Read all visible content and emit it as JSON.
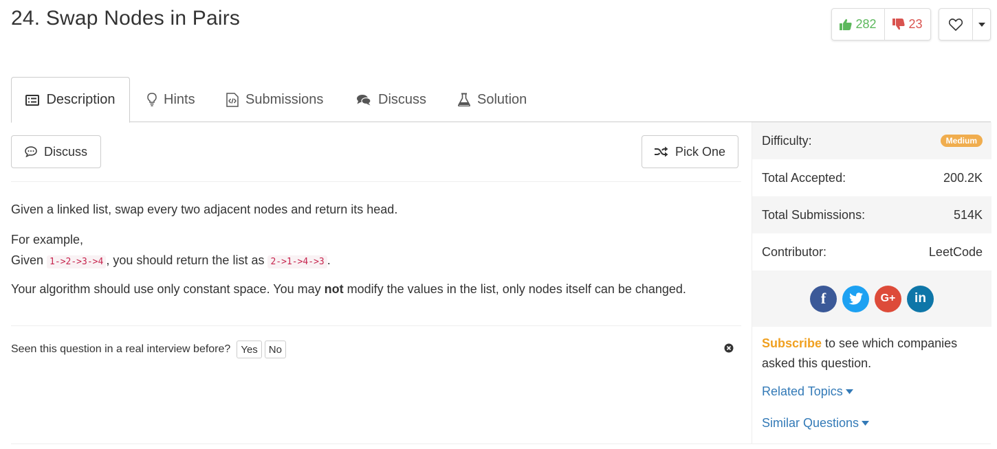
{
  "problem": {
    "title": "24. Swap Nodes in Pairs"
  },
  "votes": {
    "up": "282",
    "down": "23"
  },
  "tabs": [
    {
      "label": "Description",
      "icon": "list-icon",
      "active": true
    },
    {
      "label": "Hints",
      "icon": "lightbulb-icon"
    },
    {
      "label": "Submissions",
      "icon": "code-file-icon"
    },
    {
      "label": "Discuss",
      "icon": "comments-icon"
    },
    {
      "label": "Solution",
      "icon": "flask-icon"
    }
  ],
  "toolbar": {
    "discuss_label": "Discuss",
    "pick_one_label": "Pick One"
  },
  "description": {
    "p1": "Given a linked list, swap every two adjacent nodes and return its head.",
    "p2": "For example,",
    "given_prefix": "Given",
    "input_code": "1->2->3->4",
    "mid_text": ", you should return the list as",
    "output_code": "2->1->4->3",
    "end_text": ".",
    "p4_before": "Your algorithm should use only constant space. You may",
    "p4_bold": "not",
    "p4_after": "modify the values in the list, only nodes itself can be changed."
  },
  "interview": {
    "question": "Seen this question in a real interview before?",
    "yes": "Yes",
    "no": "No"
  },
  "sidebar": {
    "difficulty_label": "Difficulty:",
    "difficulty_value": "Medium",
    "accepted_label": "Total Accepted:",
    "accepted_value": "200.2K",
    "submissions_label": "Total Submissions:",
    "submissions_value": "514K",
    "contributor_label": "Contributor:",
    "contributor_value": "LeetCode",
    "subscribe_link": "Subscribe",
    "subscribe_text": "to see which companies asked this question.",
    "related_topics": "Related Topics",
    "similar_questions": "Similar Questions"
  },
  "social": [
    {
      "name": "facebook",
      "glyph": "f",
      "color": "#3b5998"
    },
    {
      "name": "twitter",
      "glyph": "t",
      "color": "#1da1f2"
    },
    {
      "name": "google-plus",
      "glyph": "G+",
      "color": "#dd4b39"
    },
    {
      "name": "linkedin",
      "glyph": "in",
      "color": "#0e76a8"
    }
  ],
  "colors": {
    "accent": "#337ab7",
    "upvote": "#5cb85c",
    "downvote": "#d9534f",
    "medium_badge": "#f0ad4e",
    "subscribe": "#f0a020",
    "code_text": "#c7254e"
  }
}
